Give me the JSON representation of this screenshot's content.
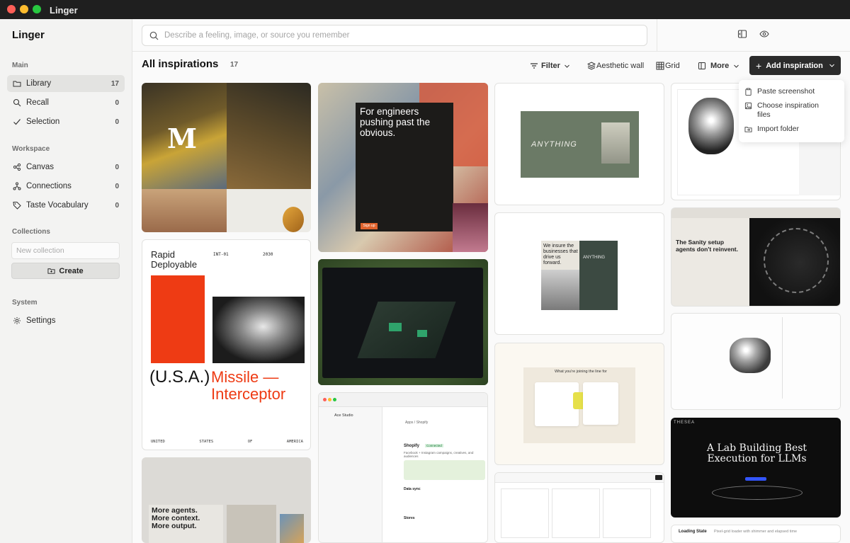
{
  "window": {
    "title": "Linger"
  },
  "sidebar": {
    "brand": "Linger",
    "sections": {
      "main": "Main",
      "workspace": "Workspace",
      "collections": "Collections",
      "system": "System"
    },
    "main_items": [
      {
        "label": "Library",
        "count": "17",
        "icon": "folder-icon"
      },
      {
        "label": "Recall",
        "count": "0",
        "icon": "search-icon"
      },
      {
        "label": "Selection",
        "count": "0",
        "icon": "check-icon"
      }
    ],
    "workspace_items": [
      {
        "label": "Canvas",
        "count": "0",
        "icon": "canvas-icon"
      },
      {
        "label": "Connections",
        "count": "0",
        "icon": "connections-icon"
      },
      {
        "label": "Taste Vocabulary",
        "count": "0",
        "icon": "tag-icon"
      }
    ],
    "new_collection_placeholder": "New collection",
    "create_label": "Create",
    "system_items": [
      {
        "label": "Settings",
        "icon": "gear-icon"
      }
    ]
  },
  "search": {
    "placeholder": "Describe a feeling, image, or source you remember"
  },
  "header": {
    "title": "All inspirations",
    "count": "17",
    "filter_label": "Filter",
    "aesthetic_label": "Aesthetic wall",
    "grid_label": "Grid",
    "more_label": "More",
    "add_label": "Add inspiration"
  },
  "add_menu": [
    {
      "label": "Paste screenshot",
      "icon": "clipboard-icon"
    },
    {
      "label": "Choose inspiration files",
      "icon": "image-file-icon"
    },
    {
      "label": "Import folder",
      "icon": "folder-import-icon"
    }
  ],
  "cards": {
    "c2": {
      "headline": "For engineers pushing past the obvious.",
      "cta": "Sign up"
    },
    "c3": {
      "brand": "ANYTHING"
    },
    "c5": {
      "top_left": "Rapid Deployable",
      "code": "INT-01",
      "year": "2030",
      "usa": "(U.S.A.)",
      "missile": "Missile — Interceptor",
      "footer": [
        "UNITED",
        "STATES",
        "OF",
        "AMERICA"
      ]
    },
    "c7": {
      "left_text": "We insure the businesses that drive us forward.",
      "brand": "ANYTHING"
    },
    "c8": {
      "headline": "The Sanity setup agents don't reinvent."
    },
    "c9": {
      "lines": [
        "More agents.",
        "More context.",
        "More output."
      ]
    },
    "c10": {
      "app": "Ace Studio",
      "crumb": "Apps / Shopify",
      "title": "Shopify",
      "badge": "Connected",
      "sub": "Facebook + Instagram campaigns, creatives, and audiences",
      "section": "Data sync",
      "stores": "Stores"
    },
    "c11": {
      "headline": "What you're joining the line for"
    },
    "c13": {
      "brand": "THESEA",
      "headline": "A Lab Building Best Execution for LLMs"
    },
    "c14": {
      "title": "Loading State",
      "sub": "Pixel-grid loader with shimmer and elapsed time"
    }
  }
}
